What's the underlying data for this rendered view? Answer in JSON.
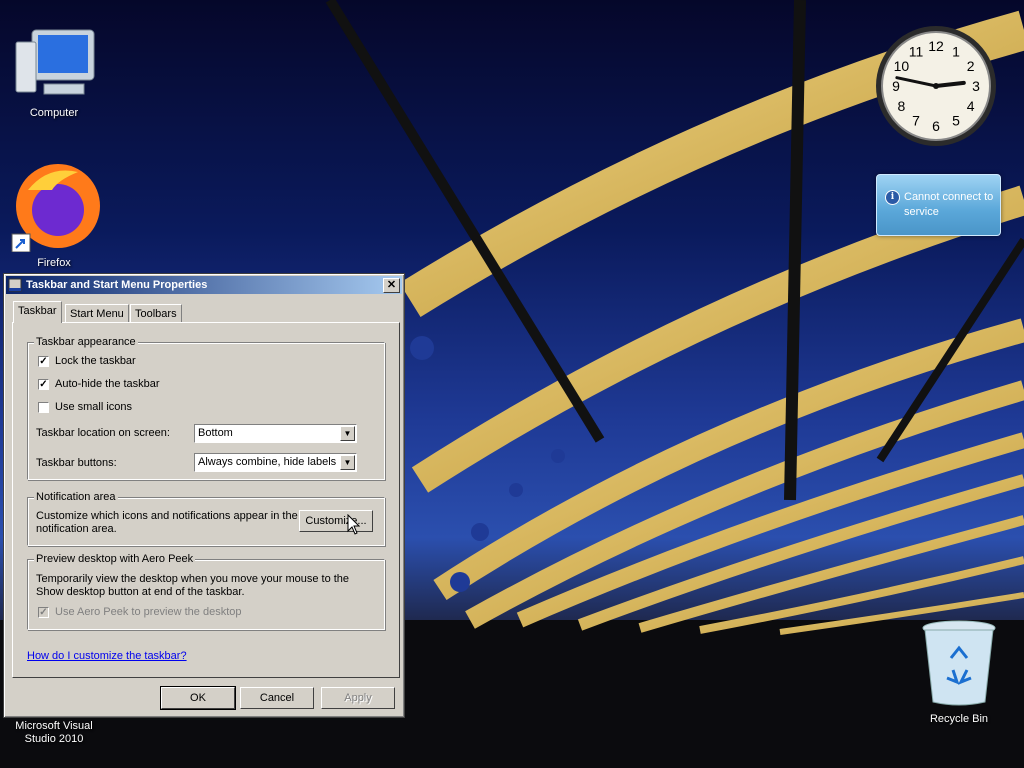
{
  "desktop": {
    "icons": [
      {
        "name": "desktop-icon-computer",
        "label": "Computer"
      },
      {
        "name": "desktop-icon-firefox",
        "label": "Firefox"
      },
      {
        "name": "desktop-icon-visual-studio",
        "label": "Microsoft Visual Studio 2010"
      },
      {
        "name": "desktop-icon-recycle-bin",
        "label": "Recycle Bin"
      }
    ]
  },
  "gadgets": {
    "clock": {
      "numerals": [
        "12",
        "1",
        "2",
        "3",
        "4",
        "5",
        "6",
        "7",
        "8",
        "9",
        "10",
        "11"
      ],
      "hour": 2,
      "minute": 47
    },
    "service": {
      "message": "Cannot connect to service"
    }
  },
  "dialog": {
    "title": "Taskbar and Start Menu Properties",
    "close_label": "✕",
    "tabs": [
      "Taskbar",
      "Start Menu",
      "Toolbars"
    ],
    "active_tab": "Taskbar",
    "appearance": {
      "title": "Taskbar appearance",
      "lock_taskbar": {
        "label": "Lock the taskbar",
        "checked": true
      },
      "auto_hide": {
        "label": "Auto-hide the taskbar",
        "checked": true
      },
      "small_icons": {
        "label": "Use small icons",
        "checked": false
      },
      "location_label": "Taskbar location on screen:",
      "location_value": "Bottom",
      "buttons_label": "Taskbar buttons:",
      "buttons_value": "Always combine, hide labels"
    },
    "notification": {
      "title": "Notification area",
      "description": "Customize which icons and notifications appear in the notification area.",
      "customize_label": "Customize..."
    },
    "aero_peek": {
      "title": "Preview desktop with Aero Peek",
      "description": "Temporarily view the desktop when you move your mouse to the Show desktop button at end of the taskbar.",
      "checkbox": {
        "label": "Use Aero Peek to preview the desktop",
        "checked": true,
        "enabled": false
      }
    },
    "help_link": "How do I customize the taskbar?",
    "buttons": {
      "ok": "OK",
      "cancel": "Cancel",
      "apply": "Apply"
    }
  },
  "colors": {
    "title_start": "#0a246a",
    "title_end": "#a6caf0",
    "link": "#0000ee",
    "dialog_bg": "#d4d0c8"
  }
}
